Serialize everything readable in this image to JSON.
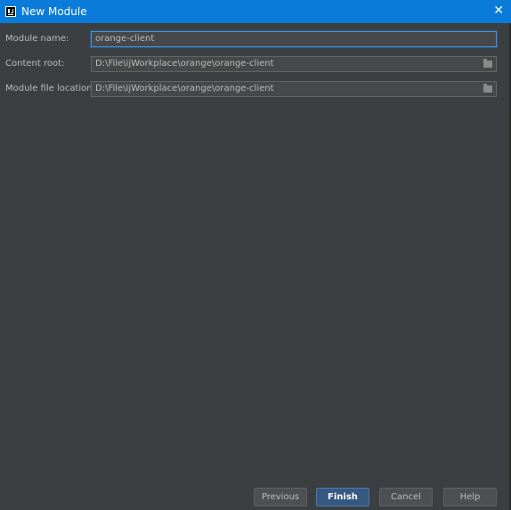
{
  "window": {
    "title": "New Module",
    "close_glyph": "✕",
    "accent_color": "#0a7bd8",
    "background_color": "#3c3f41"
  },
  "form": {
    "module_name": {
      "label": "Module name:",
      "value": "orange-client"
    },
    "content_root": {
      "label": "Content root:",
      "value": "D:\\File\\ijWorkplace\\orange\\orange-client",
      "icon": "folder-icon"
    },
    "module_file_location": {
      "label": "Module file location:",
      "value": "D:\\File\\ijWorkplace\\orange\\orange-client",
      "icon": "folder-icon"
    }
  },
  "buttons": {
    "previous": "Previous",
    "finish": "Finish",
    "cancel": "Cancel",
    "help": "Help"
  }
}
